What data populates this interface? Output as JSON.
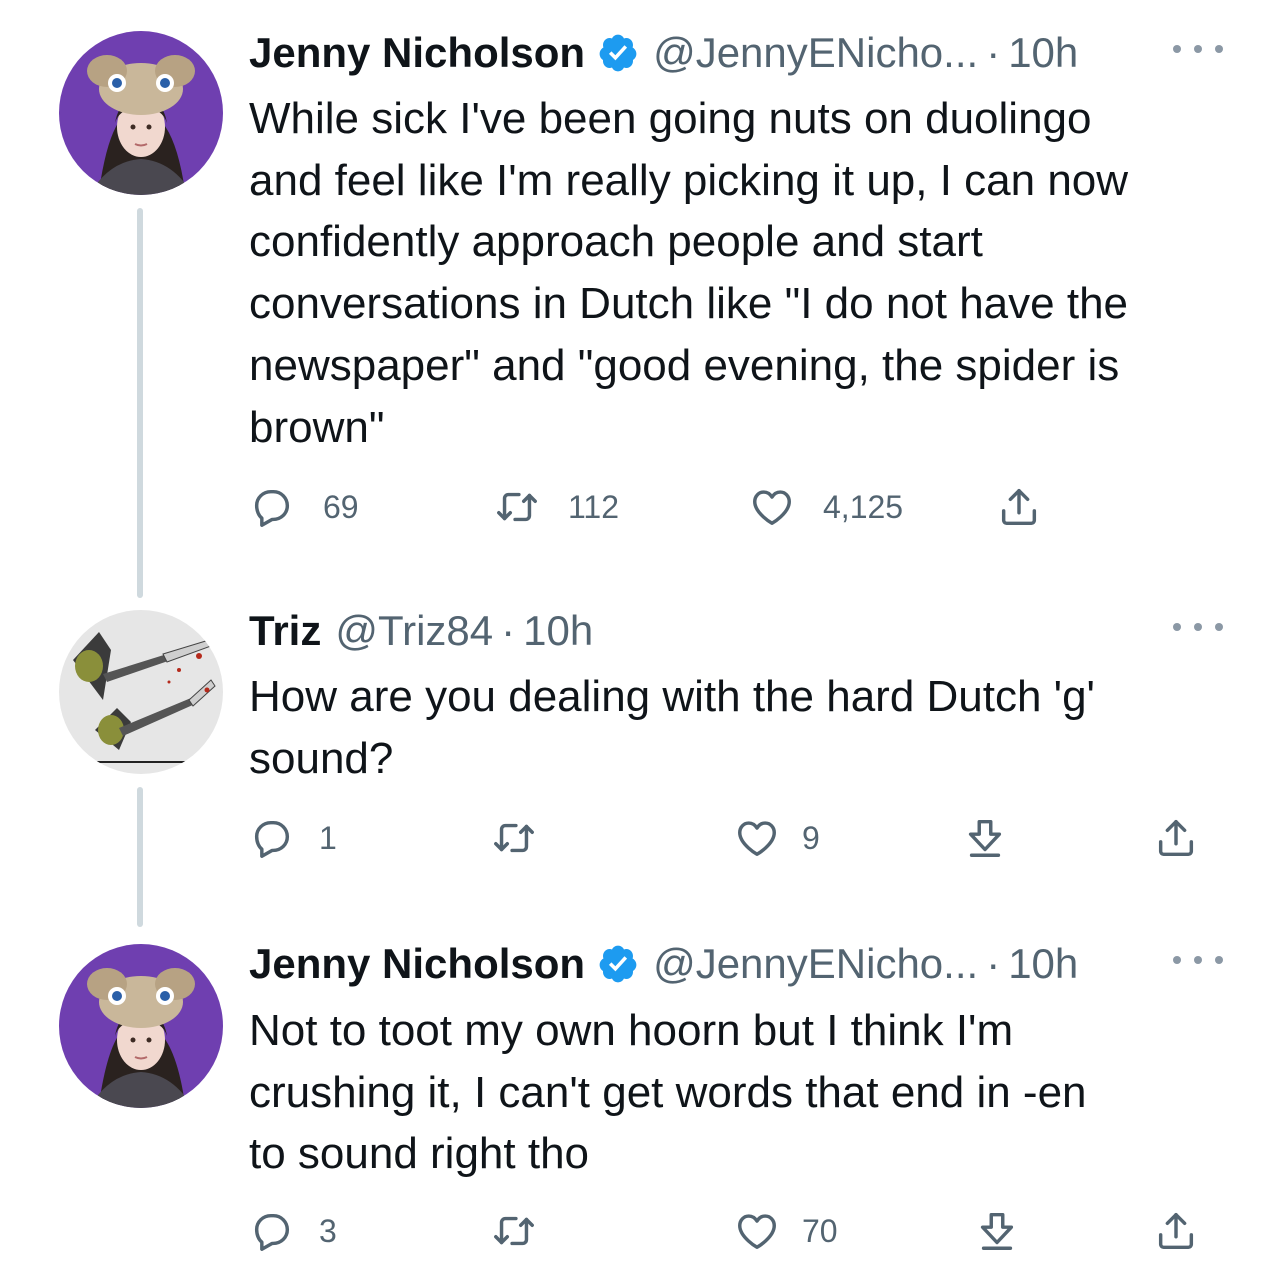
{
  "tweets": [
    {
      "author": "Jenny Nicholson",
      "verified": true,
      "handle": "@JennyENicho...",
      "separator": "·",
      "time": "10h",
      "avatar": "purple-background-et-hat-woman",
      "lines": [
        "While sick I've been going nuts on duolingo",
        "and feel like I'm really picking it up, I can now",
        "confidently approach people and start",
        "conversations in Dutch like \"I do not have the",
        "newspaper\" and \"good evening, the spider is",
        "brown\""
      ],
      "reply_count": "69",
      "retweet_count": "112",
      "like_count": "4,125"
    },
    {
      "author": "Triz",
      "verified": false,
      "handle": "@Triz84",
      "separator": "·",
      "time": "10h",
      "avatar": "knife-wielding-creatures-drawing",
      "lines": [
        "How are you dealing with the hard Dutch 'g'",
        "sound?"
      ],
      "reply_count": "1",
      "retweet_count": "",
      "like_count": "9"
    },
    {
      "author": "Jenny Nicholson",
      "verified": true,
      "handle": "@JennyENicho...",
      "separator": "·",
      "time": "10h",
      "avatar": "purple-background-et-hat-woman",
      "lines": [
        "Not to toot my own hoorn but I think I'm",
        "crushing it, I can't get words that end in -en",
        "to sound right tho"
      ],
      "reply_count": "3",
      "retweet_count": "",
      "like_count": "70"
    }
  ],
  "icons": {
    "reply": "speech-bubble-icon",
    "retweet": "retweet-arrows-icon",
    "like": "heart-outline-icon",
    "share": "upload-share-icon",
    "download": "download-arrow-icon",
    "more": "ellipsis-icon",
    "verified": "verified-badge-icon"
  },
  "colors": {
    "text": "#0f1419",
    "secondary": "#536471",
    "verified_blue": "#1d9bf0",
    "thread_line": "#cfd9de",
    "avatar_purple": "#6f3fb0"
  }
}
